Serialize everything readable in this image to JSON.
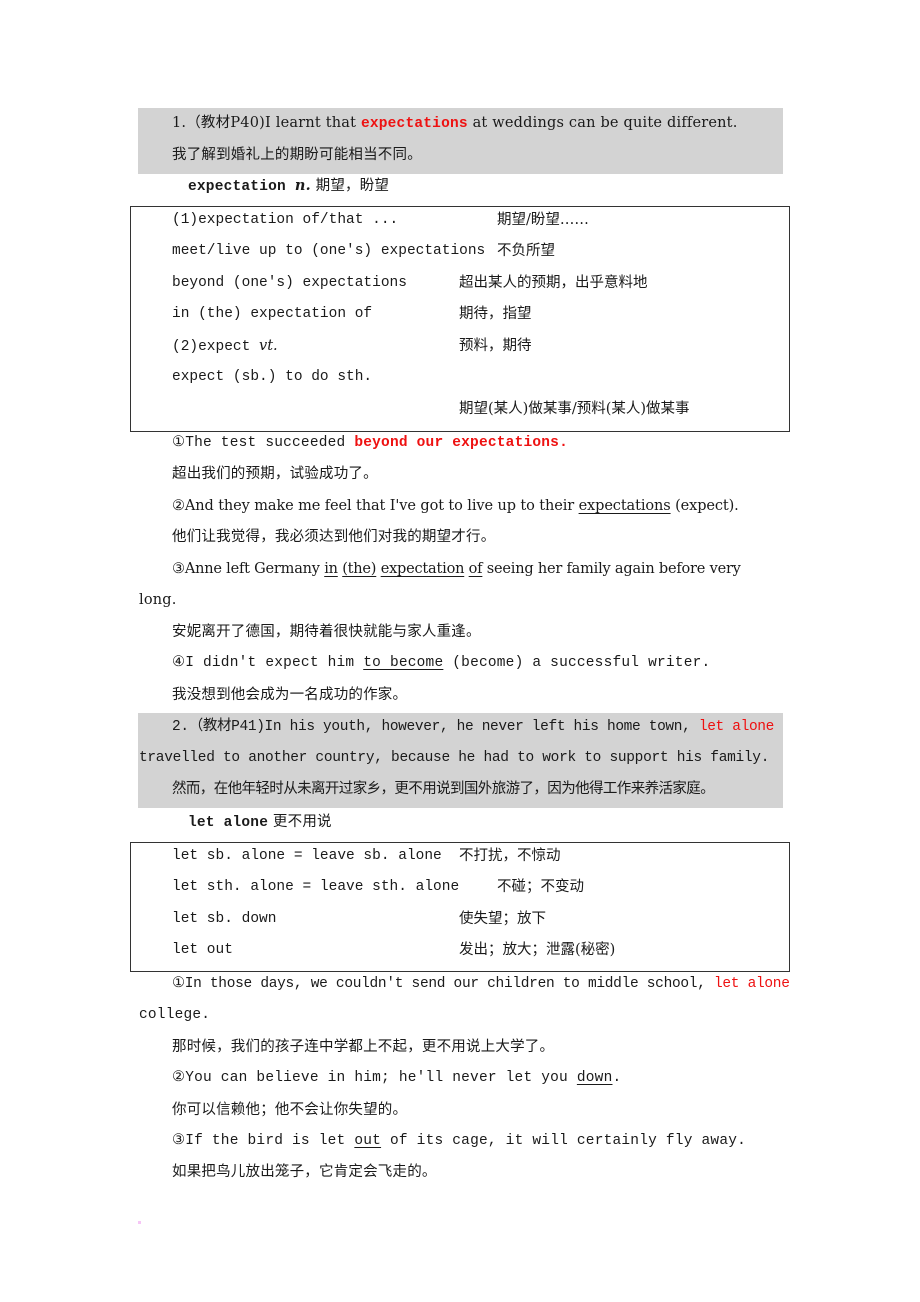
{
  "section1": {
    "heading_prefix": "1.（教材P40)I learnt that ",
    "heading_key": "expectations",
    "heading_suffix": " at weddings can be quite different.",
    "heading_translation": "我了解到婚礼上的期盼可能相当不同。",
    "entry_word": "expectation ",
    "entry_pos": "n.",
    "entry_meaning": " 期望，盼望",
    "table": [
      {
        "phrase": "(1)expectation of/that ...",
        "meaning": "期望/盼望……"
      },
      {
        "phrase": "meet/live up to (one's) expectations",
        "meaning": "不负所望"
      },
      {
        "phrase": "beyond (one's) expectations",
        "meaning": "超出某人的预期，出乎意料地"
      },
      {
        "phrase": "in (the) expectation of",
        "meaning": "期待，指望"
      },
      {
        "phrase": "(2)expect ",
        "phrase_pos": "vt.",
        "meaning": "预料，期待"
      },
      {
        "phrase": "expect (sb.) to do sth.",
        "meaning": ""
      },
      {
        "phrase": "",
        "meaning": "期望(某人)做某事/预料(某人)做某事"
      }
    ],
    "examples": [
      {
        "num": "①",
        "pre": "The test succeeded ",
        "key": "beyond our expectations.",
        "post": "",
        "translation": "超出我们的预期，试验成功了。"
      },
      {
        "num": "②",
        "pre": "And they make me feel that I've got to live up to their ",
        "key": "expectations",
        "post": " (expect).",
        "translation": "他们让我觉得，我必须达到他们对我的期望才行。"
      },
      {
        "num": "③",
        "pre": "Anne left Germany ",
        "key_parts": [
          "in",
          "(the)",
          "expectation",
          "of"
        ],
        "post": " seeing her family again before very",
        "continuation": "long.",
        "translation": "安妮离开了德国，期待着很快就能与家人重逢。"
      },
      {
        "num": "④",
        "pre": "I didn't expect him ",
        "key": "to become",
        "post": " (become) a successful writer.",
        "translation": "我没想到他会成为一名成功的作家。"
      }
    ]
  },
  "section2": {
    "heading_prefix": "2.（教材P41)In his youth, however, he never left his home town, ",
    "heading_key": "let alone",
    "heading_line2": "travelled to another country, because he had to work to support his family.",
    "heading_translation": "然而，在他年轻时从未离开过家乡，更不用说到国外旅游了，因为他得工作来养活家庭。",
    "entry_word": "let alone",
    "entry_meaning": " 更不用说",
    "table": [
      {
        "phrase": "let sb. alone = leave sb. alone",
        "meaning": "不打扰，不惊动"
      },
      {
        "phrase": "let sth. alone = leave sth. alone",
        "meaning": "不碰；不变动"
      },
      {
        "phrase": "let sb. down",
        "meaning": "使失望；放下"
      },
      {
        "phrase": "let out",
        "meaning": "发出；放大；泄露(秘密)"
      }
    ],
    "examples": [
      {
        "num": "①",
        "pre": "In those days, we couldn't send our children to middle school, ",
        "key": "let alone",
        "continuation": "college.",
        "translation": "那时候，我们的孩子连中学都上不起，更不用说上大学了。"
      },
      {
        "num": "②",
        "pre": "You can believe in him; he'll never let you ",
        "key": "down",
        "post": ".",
        "translation": "你可以信赖他；他不会让你失望的。"
      },
      {
        "num": "③",
        "pre": "If the bird is let ",
        "key": "out",
        "post": " of its cage, it will certainly fly away.",
        "translation": "如果把鸟儿放出笼子，它肯定会飞走的。"
      }
    ]
  },
  "colors": {
    "highlight": "#ee1111",
    "shade": "#d8d8d8",
    "text": "#1a1a1a",
    "border": "#333333"
  }
}
